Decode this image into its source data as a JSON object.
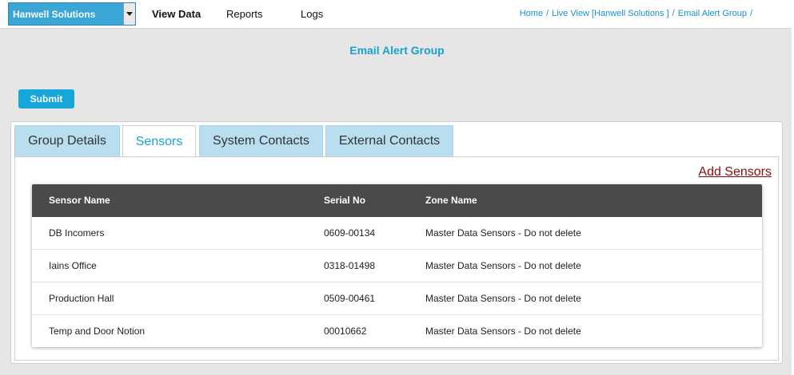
{
  "header": {
    "org_selected": "Hanwell Solutions",
    "nav": [
      "View Data",
      "Reports",
      "Logs"
    ],
    "breadcrumb": [
      "Home",
      "Live View [Hanwell Solutions ]",
      "Email Alert Group"
    ]
  },
  "page": {
    "title": "Email Alert Group",
    "submit_label": "Submit"
  },
  "tabs": [
    {
      "label": "Group Details",
      "active": false
    },
    {
      "label": "Sensors",
      "active": true
    },
    {
      "label": "System Contacts",
      "active": false
    },
    {
      "label": "External Contacts",
      "active": false
    }
  ],
  "sensors": {
    "add_link": "Add Sensors",
    "columns": [
      "Sensor Name",
      "Serial No",
      "Zone Name"
    ],
    "rows": [
      [
        "DB Incomers",
        "0609-00134",
        "Master Data Sensors - Do not delete"
      ],
      [
        "Iains Office",
        "0318-01498",
        "Master Data Sensors - Do not delete"
      ],
      [
        "Production Hall",
        "0509-00461",
        "Master Data Sensors - Do not delete"
      ],
      [
        "Temp and Door Notion",
        "00010662",
        "Master Data Sensors - Do not delete"
      ]
    ]
  },
  "colors": {
    "accent": "#17a1cf",
    "header_row": "#4a4a4a",
    "tab_inactive": "#b9def0",
    "link": "#8b0b0b"
  },
  "icons": {
    "org_dropdown": "chevron-down-icon"
  }
}
